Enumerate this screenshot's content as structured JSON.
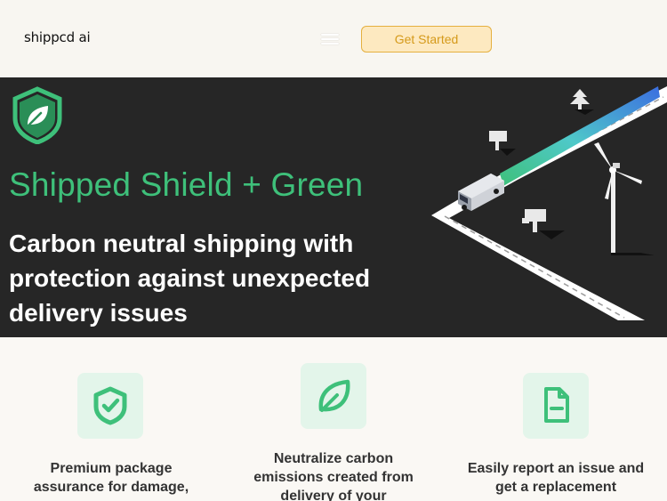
{
  "header": {
    "logo_text": "shippcd ai",
    "menu_icon": "hamburger-menu-icon",
    "cta_label": "Get Started"
  },
  "hero": {
    "logo_icon": "shield-leaf-icon",
    "title": "Shipped Shield + Green",
    "subtitle": "Carbon neutral shipping with protection against unexpected delivery issues",
    "illustration": "delivery-van-wind-turbine-illustration"
  },
  "features": [
    {
      "icon": "shield-check-icon",
      "text": "Premium package assurance for damage,"
    },
    {
      "icon": "leaf-icon",
      "text": "Neutralize carbon emissions created from delivery of your"
    },
    {
      "icon": "document-minus-icon",
      "text": "Easily report an issue and get a replacement"
    }
  ],
  "colors": {
    "brand_green": "#3ec07a",
    "hero_bg": "#262626",
    "cta_bg": "#fde9c0",
    "cta_border": "#e5b03f",
    "cta_text": "#d59a1a",
    "icon_tile_bg": "#e3f5ea"
  }
}
